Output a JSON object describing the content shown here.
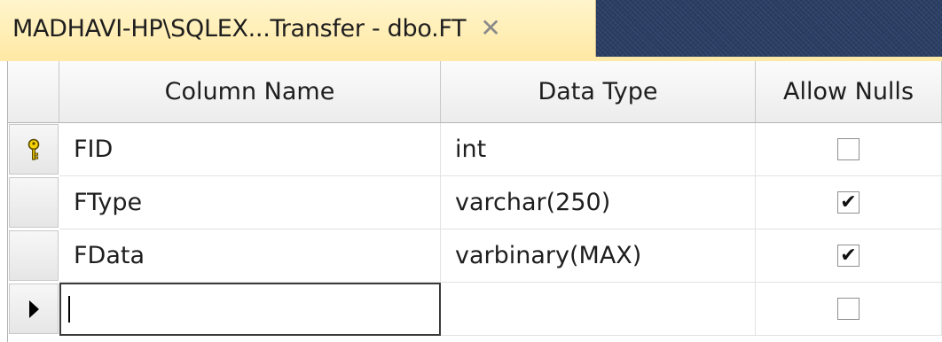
{
  "tab": {
    "title": "MADHAVI-HP\\SQLEX...Transfer - dbo.FT",
    "close_glyph": "✕"
  },
  "columns": {
    "name": "Column Name",
    "type": "Data Type",
    "nulls": "Allow Nulls"
  },
  "rows": [
    {
      "indicator": "primary-key-icon",
      "name": "FID",
      "type": "int",
      "allow_nulls": false
    },
    {
      "indicator": "",
      "name": "FType",
      "type": "varchar(250)",
      "allow_nulls": true
    },
    {
      "indicator": "",
      "name": "FData",
      "type": "varbinary(MAX)",
      "allow_nulls": true
    },
    {
      "indicator": "current-row-arrow-icon",
      "name": "",
      "type": "",
      "allow_nulls": false
    }
  ],
  "colors": {
    "tab_active": "#ffe9a6",
    "tabstrip_bg": "#2b3e64",
    "key_icon": "#d8b000"
  }
}
